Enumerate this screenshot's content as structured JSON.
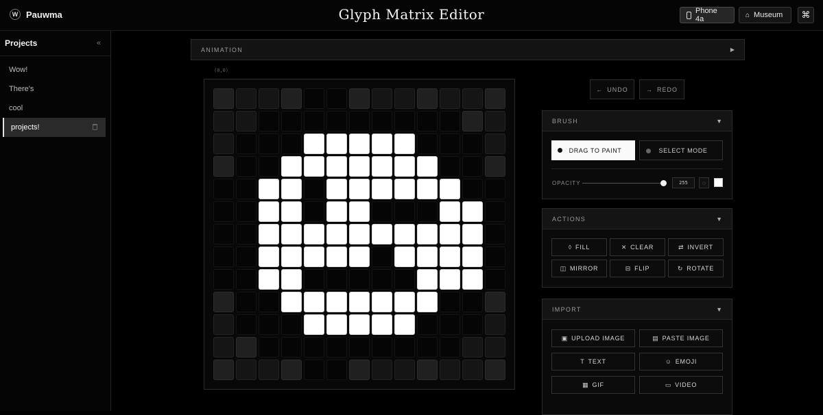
{
  "header": {
    "brand": "Pauwma",
    "brand_icon": "W",
    "title": "Glyph Matrix Editor",
    "device_label": "Phone 4a",
    "museum_label": "Museum",
    "cmd_glyph": "⌘"
  },
  "sidebar": {
    "title": "Projects",
    "collapse_glyph": "«",
    "items": [
      {
        "label": "Wow!",
        "active": false
      },
      {
        "label": "There's",
        "active": false
      },
      {
        "label": "cool",
        "active": false
      },
      {
        "label": "projects!",
        "active": true
      }
    ]
  },
  "animation": {
    "label": "ANIMATION",
    "toggle_glyph": "▶"
  },
  "coordinate": "(0,0)",
  "matrix": {
    "size": 13,
    "on_color": "#ffffff",
    "rows": [
      "0000000000000",
      "0000000000000",
      "0000111110000",
      "0001111111000",
      "0011011111100",
      "0011011000110",
      "0011111111110",
      "0011111011110",
      "0011000001110",
      "0001111111000",
      "0000111110000",
      "0000000000000",
      "0000000000000"
    ],
    "mask": [
      "1111001111111",
      "1100000000011",
      "1000000000001",
      "1000000000001",
      "0000000000000",
      "0000000000000",
      "0000000000000",
      "0000000000000",
      "0000000000000",
      "1000000000001",
      "1000000000001",
      "1100000000011",
      "1111001111111"
    ]
  },
  "history": {
    "undo_label": "UNDO",
    "redo_label": "REDO",
    "undo_icon": "←",
    "redo_icon": "→"
  },
  "brush": {
    "label": "BRUSH",
    "caret": "▼",
    "paint_label": "DRAG TO PAINT",
    "select_label": "SELECT MODE",
    "opacity_label": "OPACITY",
    "opacity_value": "255",
    "opacity_fraction": 1.0,
    "drop_glyph": "◌"
  },
  "actions": {
    "label": "ACTIONS",
    "caret": "▼",
    "buttons": [
      {
        "label": "FILL",
        "icon": "◊"
      },
      {
        "label": "CLEAR",
        "icon": "✕"
      },
      {
        "label": "INVERT",
        "icon": "⇄"
      },
      {
        "label": "MIRROR",
        "icon": "◫"
      },
      {
        "label": "FLIP",
        "icon": "⊟"
      },
      {
        "label": "ROTATE",
        "icon": "↻"
      }
    ]
  },
  "import": {
    "label": "IMPORT",
    "caret": "▼",
    "buttons": [
      {
        "label": "UPLOAD IMAGE",
        "icon": "▣"
      },
      {
        "label": "PASTE IMAGE",
        "icon": "▤"
      },
      {
        "label": "TEXT",
        "icon": "T"
      },
      {
        "label": "EMOJI",
        "icon": "☺"
      },
      {
        "label": "GIF",
        "icon": "▦"
      },
      {
        "label": "VIDEO",
        "icon": "▭"
      }
    ]
  }
}
